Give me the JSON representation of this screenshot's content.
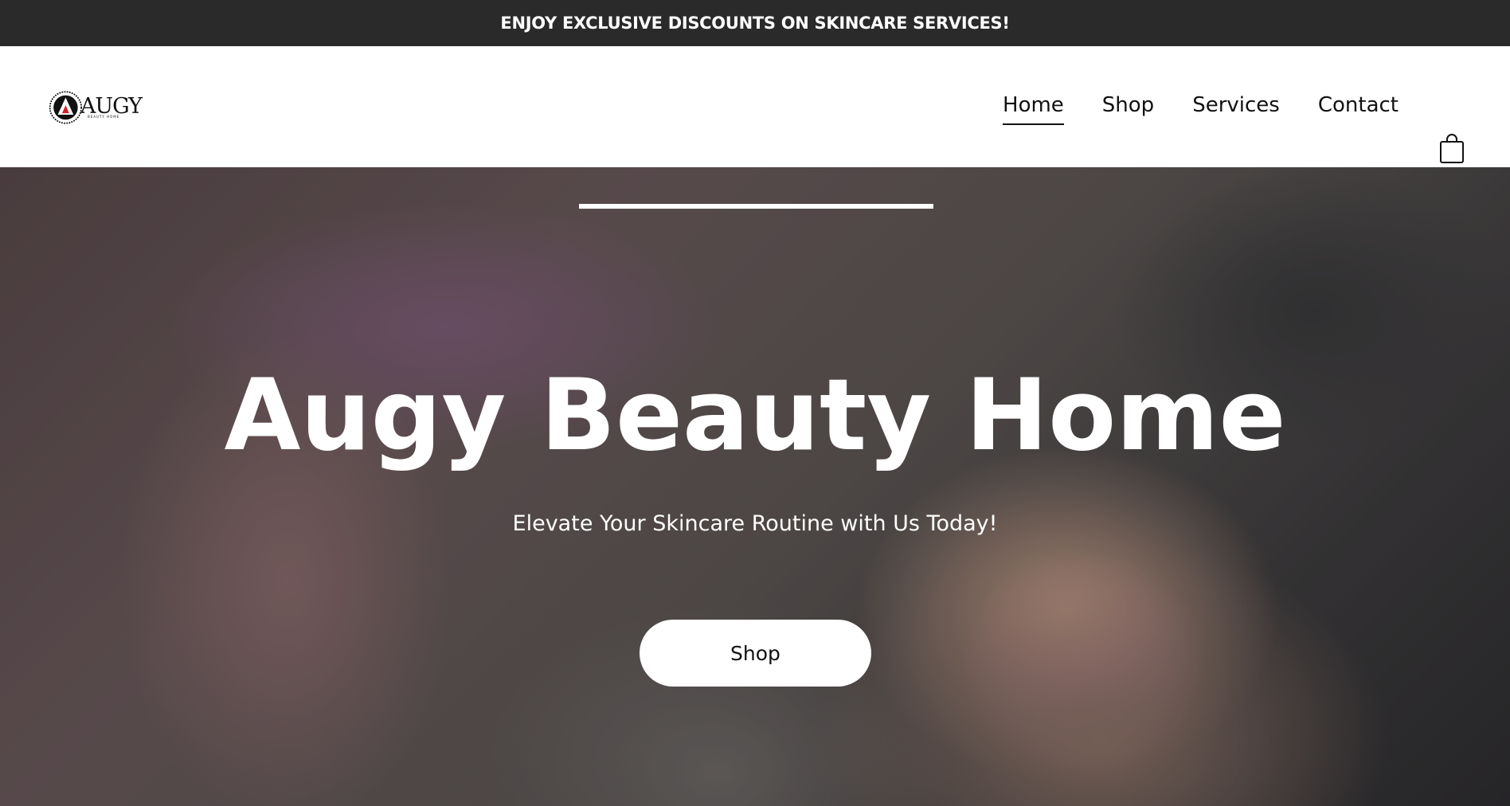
{
  "announcement": {
    "text": "ENJOY EXCLUSIVE DISCOUNTS ON SKINCARE SERVICES!"
  },
  "header": {
    "logo_text": "AUGY",
    "logo_tagline": "BEAUTY HOME",
    "nav": [
      {
        "label": "Home",
        "active": true
      },
      {
        "label": "Shop",
        "active": false
      },
      {
        "label": "Services",
        "active": false
      },
      {
        "label": "Contact",
        "active": false
      }
    ],
    "cart_icon": "shopping-bag-icon"
  },
  "hero": {
    "title": "Augy Beauty Home",
    "subtitle": "Elevate Your Skincare Routine with Us Today!",
    "cta_label": "Shop"
  },
  "colors": {
    "announcement_bg": "#2a2a2a",
    "header_bg": "#ffffff",
    "text_dark": "#111111",
    "hero_text": "#ffffff",
    "logo_accent": "#d32027"
  }
}
